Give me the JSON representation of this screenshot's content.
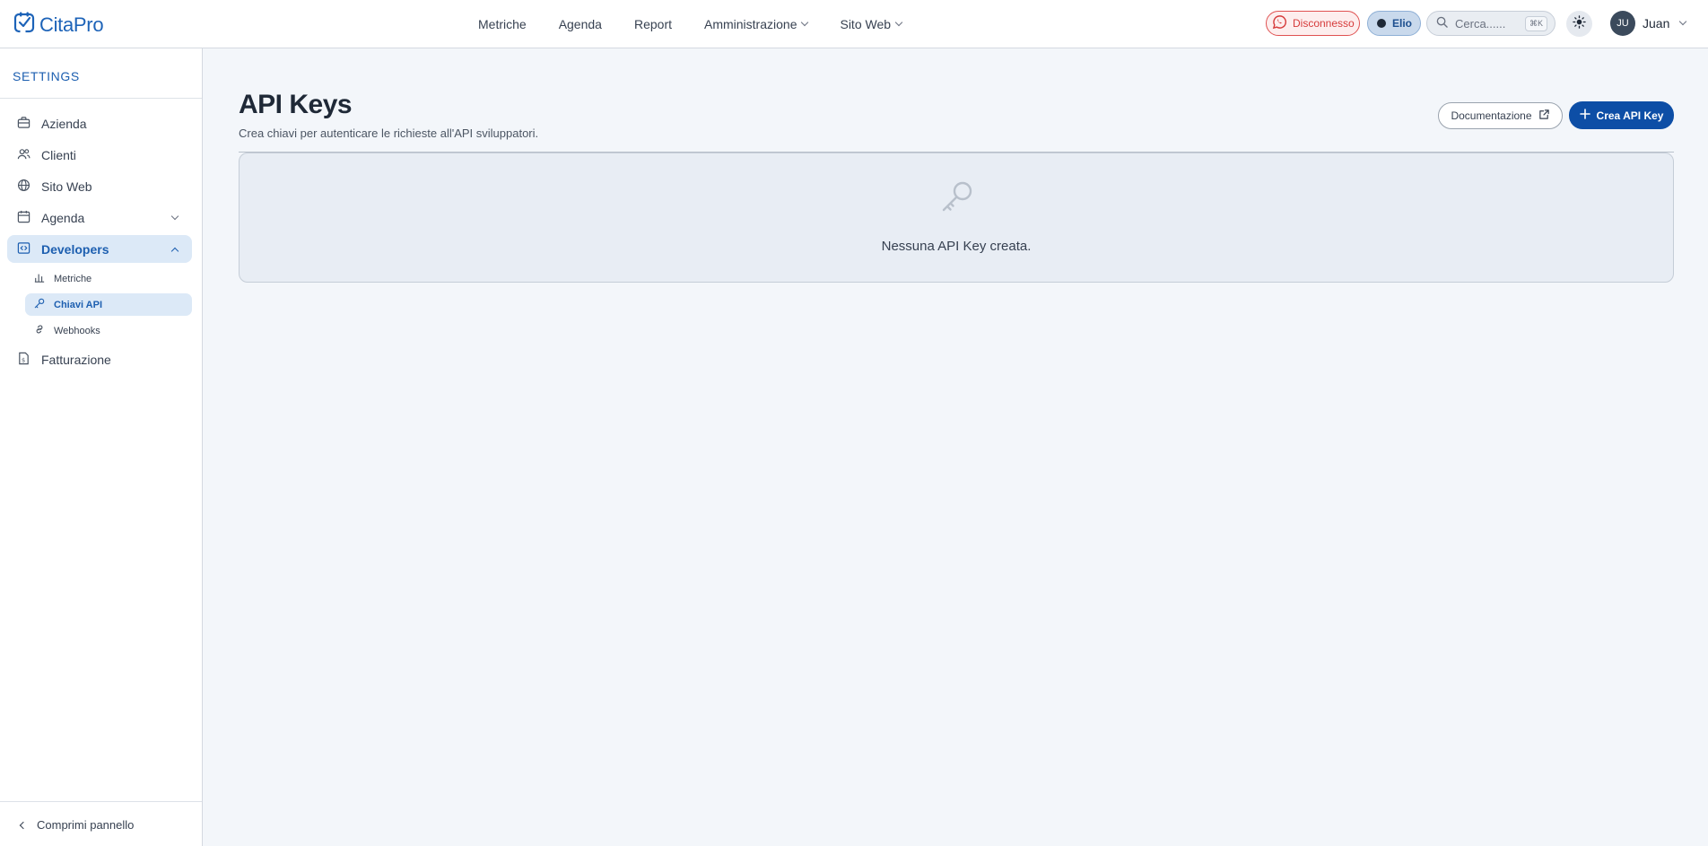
{
  "app": {
    "name": "CitaPro",
    "brand_color": "#1d63b8"
  },
  "nav": {
    "items": [
      {
        "label": "Metriche"
      },
      {
        "label": "Agenda"
      },
      {
        "label": "Report"
      },
      {
        "label": "Amministrazione"
      },
      {
        "label": "Sito Web"
      }
    ]
  },
  "header": {
    "whatsapp_status": "Disconnesso",
    "assistant_label": "Elio",
    "search_placeholder": "Cerca......",
    "search_shortcut": "⌘K",
    "user_initials": "JU",
    "user_name": "Juan"
  },
  "sidebar": {
    "title": "SETTINGS",
    "items": [
      {
        "label": "Azienda",
        "icon": "briefcase-icon"
      },
      {
        "label": "Clienti",
        "icon": "users-icon"
      },
      {
        "label": "Sito Web",
        "icon": "globe-icon"
      },
      {
        "label": "Agenda",
        "icon": "calendar-icon"
      },
      {
        "label": "Developers",
        "icon": "code-icon"
      },
      {
        "label": "Fatturazione",
        "icon": "invoice-icon"
      }
    ],
    "developer_subitems": [
      {
        "label": "Metriche",
        "icon": "bar-chart-icon"
      },
      {
        "label": "Chiavi API",
        "icon": "key-icon"
      },
      {
        "label": "Webhooks",
        "icon": "link-icon"
      }
    ],
    "collapse_label": "Comprimi pannello"
  },
  "main": {
    "title": "API Keys",
    "subtitle": "Crea chiavi per autenticare le richieste all'API sviluppatori.",
    "documentation_button": "Documentazione",
    "create_button": "Crea API Key",
    "empty_message": "Nessuna API Key creata."
  }
}
